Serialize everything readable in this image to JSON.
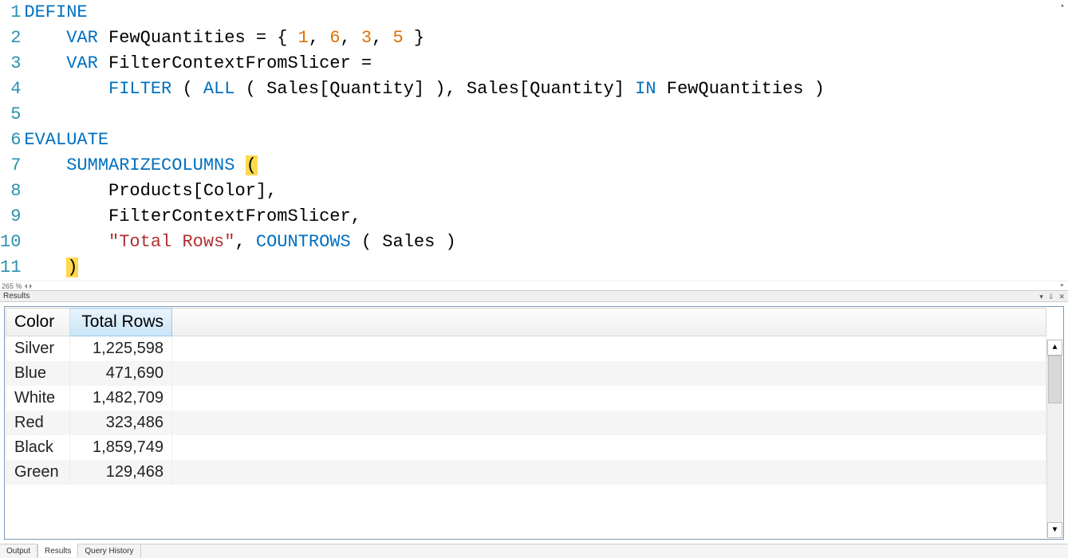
{
  "editor": {
    "zoom_label": "265 %",
    "lines": [
      {
        "n": 1,
        "tokens": [
          {
            "t": "DEFINE",
            "c": "kw"
          }
        ]
      },
      {
        "n": 2,
        "tokens": [
          {
            "t": "    ",
            "c": "plain"
          },
          {
            "t": "VAR",
            "c": "kw"
          },
          {
            "t": " FewQuantities = { ",
            "c": "plain"
          },
          {
            "t": "1",
            "c": "num"
          },
          {
            "t": ", ",
            "c": "plain"
          },
          {
            "t": "6",
            "c": "num"
          },
          {
            "t": ", ",
            "c": "plain"
          },
          {
            "t": "3",
            "c": "num"
          },
          {
            "t": ", ",
            "c": "plain"
          },
          {
            "t": "5",
            "c": "num"
          },
          {
            "t": " }",
            "c": "plain"
          }
        ]
      },
      {
        "n": 3,
        "tokens": [
          {
            "t": "    ",
            "c": "plain"
          },
          {
            "t": "VAR",
            "c": "kw"
          },
          {
            "t": " FilterContextFromSlicer =",
            "c": "plain"
          }
        ]
      },
      {
        "n": 4,
        "tokens": [
          {
            "t": "        ",
            "c": "plain"
          },
          {
            "t": "FILTER",
            "c": "fn"
          },
          {
            "t": " ( ",
            "c": "plain"
          },
          {
            "t": "ALL",
            "c": "fn"
          },
          {
            "t": " ( Sales[Quantity] ), Sales[Quantity] ",
            "c": "plain"
          },
          {
            "t": "IN",
            "c": "kw"
          },
          {
            "t": " FewQuantities )",
            "c": "plain"
          }
        ]
      },
      {
        "n": 5,
        "tokens": [
          {
            "t": "",
            "c": "plain"
          }
        ]
      },
      {
        "n": 6,
        "tokens": [
          {
            "t": "EVALUATE",
            "c": "kw"
          }
        ]
      },
      {
        "n": 7,
        "tokens": [
          {
            "t": "    ",
            "c": "plain"
          },
          {
            "t": "SUMMARIZECOLUMNS",
            "c": "fn"
          },
          {
            "t": " ",
            "c": "plain"
          },
          {
            "t": "(",
            "c": "brace-match"
          }
        ]
      },
      {
        "n": 8,
        "tokens": [
          {
            "t": "        Products[Color],",
            "c": "plain"
          }
        ]
      },
      {
        "n": 9,
        "tokens": [
          {
            "t": "        FilterContextFromSlicer,",
            "c": "plain"
          }
        ]
      },
      {
        "n": 10,
        "tokens": [
          {
            "t": "        ",
            "c": "plain"
          },
          {
            "t": "\"Total Rows\"",
            "c": "str"
          },
          {
            "t": ", ",
            "c": "plain"
          },
          {
            "t": "COUNTROWS",
            "c": "fn"
          },
          {
            "t": " ( Sales )",
            "c": "plain"
          }
        ]
      },
      {
        "n": 11,
        "tokens": [
          {
            "t": "    ",
            "c": "plain"
          },
          {
            "t": ")",
            "c": "brace-match"
          }
        ]
      }
    ]
  },
  "results_panel": {
    "title": "Results",
    "columns": [
      {
        "label": "Color",
        "sorted": false
      },
      {
        "label": "Total Rows",
        "sorted": true
      }
    ],
    "rows": [
      {
        "color": "Silver",
        "total": "1,225,598"
      },
      {
        "color": "Blue",
        "total": "471,690"
      },
      {
        "color": "White",
        "total": "1,482,709"
      },
      {
        "color": "Red",
        "total": "323,486"
      },
      {
        "color": "Black",
        "total": "1,859,749"
      },
      {
        "color": "Green",
        "total": "129,468"
      }
    ]
  },
  "bottom_tabs": {
    "items": [
      {
        "label": "Output",
        "active": false
      },
      {
        "label": "Results",
        "active": true
      },
      {
        "label": "Query History",
        "active": false
      }
    ]
  }
}
